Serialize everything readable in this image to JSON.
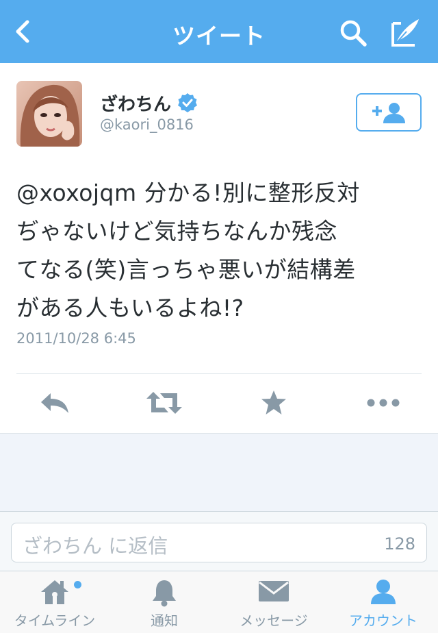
{
  "colors": {
    "accent": "#55acee",
    "text": "#292f33",
    "muted": "#8899a6",
    "background_gray": "#f0f4fa"
  },
  "navbar": {
    "title": "ツイート",
    "back_icon": "chevron-left-icon",
    "search_icon": "search-icon",
    "compose_icon": "compose-icon"
  },
  "tweet": {
    "author_name": "ざわちん",
    "author_handle": "@kaori_0816",
    "verified": true,
    "text_lines": [
      "@xoxojqm 分かる!別に整形反対",
      "ぢゃないけど気持ちなんか残念",
      "てなる(笑)言っちゃ悪いが結構差",
      "がある人もいるよね!?"
    ],
    "timestamp": "2011/10/28 6:45"
  },
  "actions": [
    "reply-icon",
    "retweet-icon",
    "favorite-star-icon",
    "more-dots-icon"
  ],
  "reply_bar": {
    "placeholder": "ざわちん に返信",
    "char_count": "128"
  },
  "tabbar": {
    "tabs": [
      {
        "label": "タイムライン",
        "icon": "home-icon",
        "active": false,
        "unread": true
      },
      {
        "label": "通知",
        "icon": "bell-icon",
        "active": false,
        "unread": false
      },
      {
        "label": "メッセージ",
        "icon": "envelope-icon",
        "active": false,
        "unread": false
      },
      {
        "label": "アカウント",
        "icon": "person-icon",
        "active": true,
        "unread": false
      }
    ]
  }
}
